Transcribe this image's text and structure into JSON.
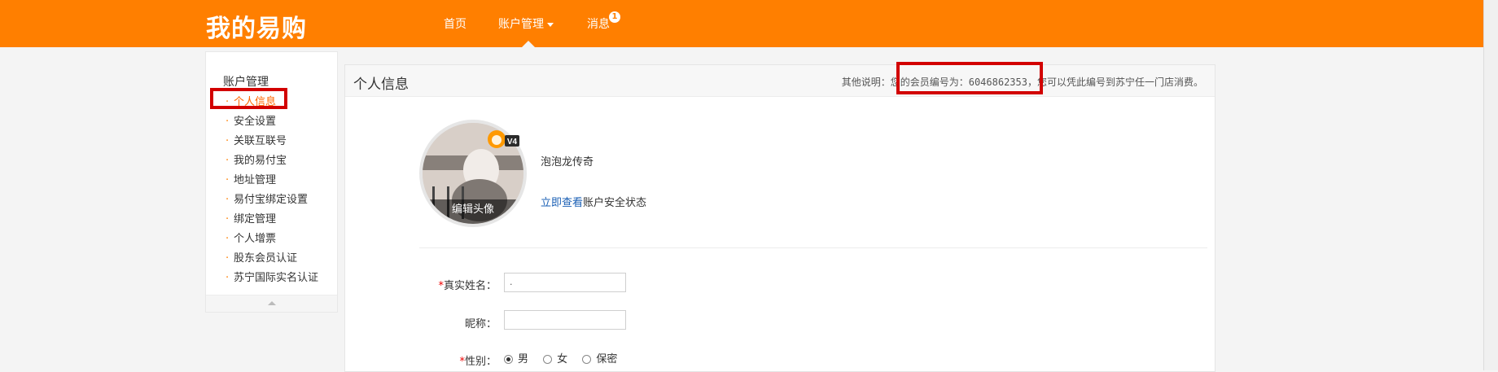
{
  "header": {
    "logo": "我的易购",
    "nav": {
      "home": "首页",
      "account": "账户管理",
      "messages": "消息",
      "messages_badge": "1"
    }
  },
  "sidebar": {
    "title": "账户管理",
    "items": [
      {
        "label": "个人信息",
        "active": true
      },
      {
        "label": "安全设置"
      },
      {
        "label": "关联互联号"
      },
      {
        "label": "我的易付宝"
      },
      {
        "label": "地址管理"
      },
      {
        "label": "易付宝绑定设置"
      },
      {
        "label": "绑定管理"
      },
      {
        "label": "个人增票"
      },
      {
        "label": "股东会员认证"
      },
      {
        "label": "苏宁国际实名认证"
      }
    ]
  },
  "main": {
    "title": "个人信息",
    "notice": {
      "prefix": "其他说明：",
      "member_label": "您的会员编号为：",
      "member_number": "6046862353",
      "suffix": "，您可以凭此编号到苏宁任一门店消费。"
    },
    "profile": {
      "avatar_edit": "编辑头像",
      "vip_level": "V4",
      "username": "泡泡龙传奇",
      "security_link": "立即查看",
      "security_suffix": "账户安全状态"
    },
    "form": {
      "real_name_label": "真实姓名：",
      "real_name_value": ".",
      "nickname_label": "昵称：",
      "nickname_value": "",
      "gender_label": "性别：",
      "gender_options": [
        "男",
        "女",
        "保密"
      ],
      "gender_selected": "男",
      "required_mark": "*"
    }
  }
}
